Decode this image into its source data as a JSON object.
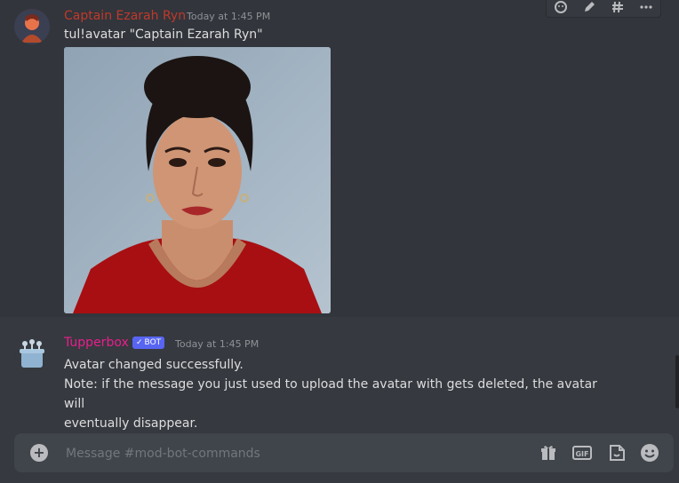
{
  "messages": [
    {
      "author": "Captain Ezarah Ryn",
      "timestamp": "Today at 1:45 PM",
      "content": "tul!avatar \"Captain Ezarah Ryn\"",
      "attachment": "portrait image"
    },
    {
      "author": "Tupperbox",
      "badge": "BOT",
      "timestamp": "Today at 1:45 PM",
      "lines": [
        "Avatar changed successfully.",
        "Note: if the message you just used to upload the avatar with gets deleted, the avatar will",
        "eventually disappear."
      ]
    }
  ],
  "composer": {
    "placeholder": "Message #mod-bot-commands",
    "icons": [
      "plus-icon",
      "gift-icon",
      "gif-icon",
      "sticker-icon",
      "emoji-icon"
    ]
  },
  "hover_toolbar": {
    "icons": [
      "add-reaction-icon",
      "edit-icon",
      "thread-icon",
      "more-icon"
    ]
  },
  "colors": {
    "author1": "#c0392b",
    "author2": "#e91e8c",
    "bot_badge": "#5865f2",
    "background": "#36393f",
    "composer": "#40444b"
  }
}
